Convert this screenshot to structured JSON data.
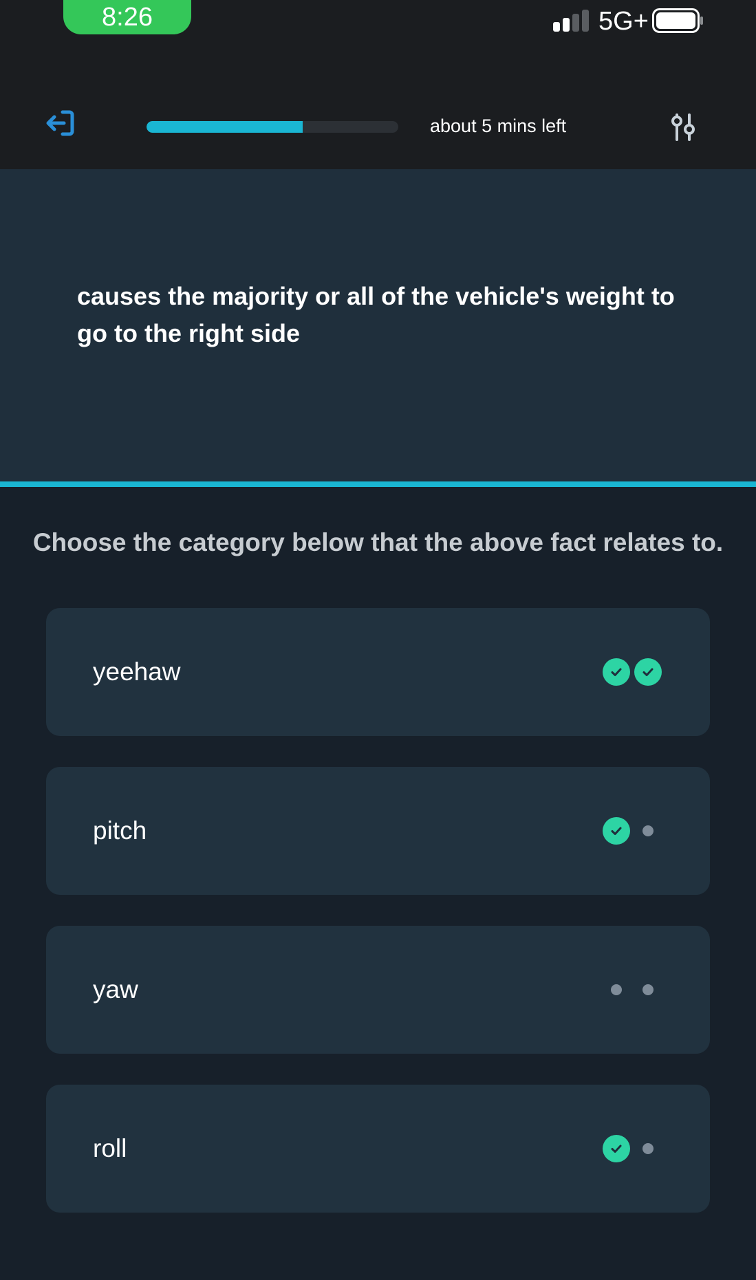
{
  "status_bar": {
    "time": "8:26",
    "network": "5G+"
  },
  "topbar": {
    "exit_icon": "exit-icon",
    "progress_percent": 62,
    "time_left": "about 5 mins left",
    "settings_icon": "sliders-icon"
  },
  "question": {
    "fact": "causes the majority or all of the vehicle's weight to go to the right side",
    "instruction": "Choose the category below that the above fact relates to."
  },
  "options": [
    {
      "label": "yeehaw",
      "marks": [
        "check",
        "check"
      ]
    },
    {
      "label": "pitch",
      "marks": [
        "check",
        "dot"
      ]
    },
    {
      "label": "yaw",
      "marks": [
        "dot",
        "dot"
      ]
    },
    {
      "label": "roll",
      "marks": [
        "check",
        "dot"
      ]
    }
  ],
  "colors": {
    "accent": "#1ab6d3",
    "check": "#2dd4a4",
    "pill": "#34c759"
  }
}
